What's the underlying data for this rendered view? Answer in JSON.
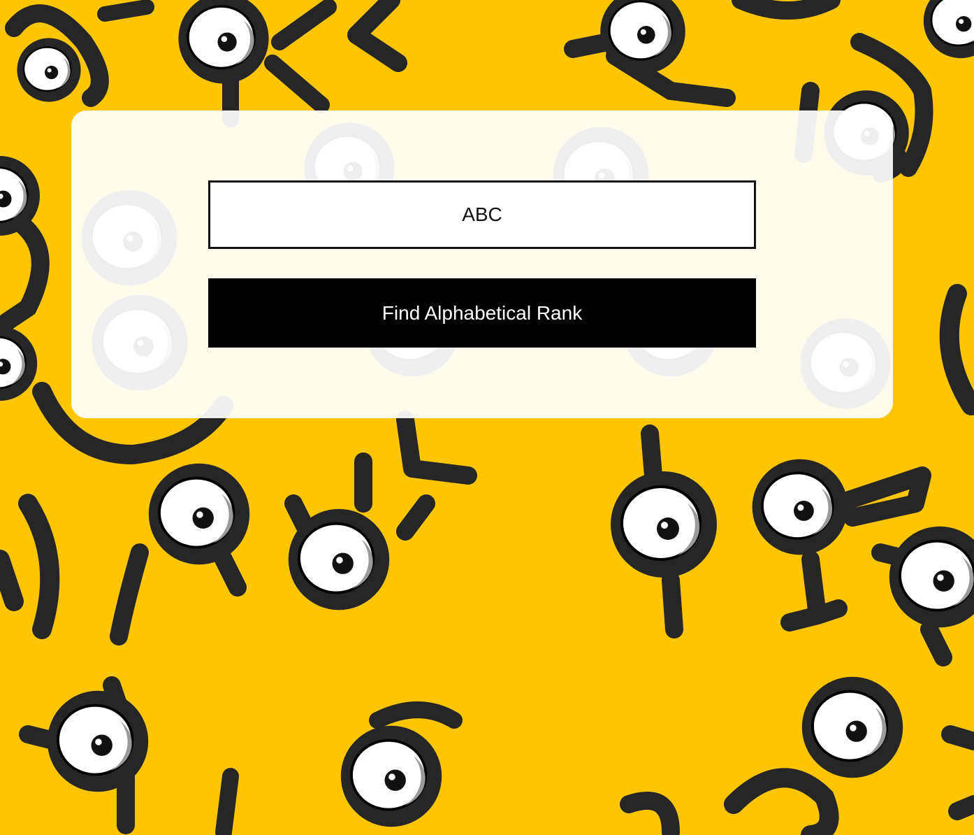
{
  "page": {
    "background_color": "#FFC600"
  },
  "form": {
    "word_input_value": "ABC",
    "submit_label": "Find Alphabetical Rank"
  },
  "background": {
    "pattern": "unown-creatures-icon"
  }
}
